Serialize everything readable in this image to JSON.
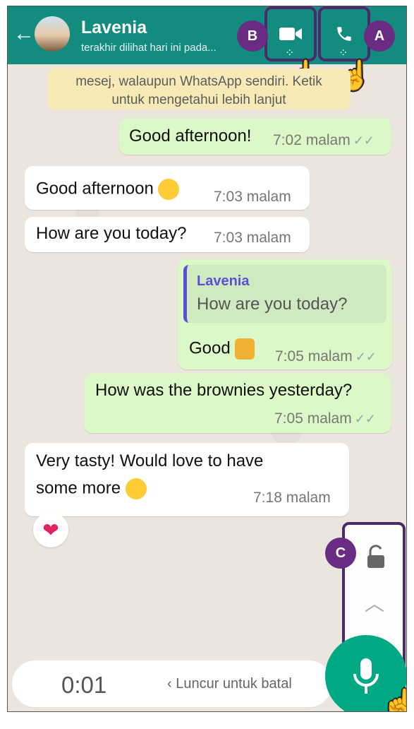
{
  "header": {
    "contact_name": "Lavenia",
    "last_seen": "terakhir dilihat hari ini pada...",
    "accent_color": "#128c7e"
  },
  "callouts": {
    "a": "A",
    "b": "B",
    "c": "C"
  },
  "notice": {
    "line1": "mesej, walaupun WhatsApp sendiri. Ketik",
    "line2": "untuk mengetahui lebih lanjut"
  },
  "messages": [
    {
      "text": "Good afternoon!",
      "time": "7:02 malam"
    },
    {
      "text": "Good afternoon",
      "time": "7:03 malam"
    },
    {
      "text": "How are you today?",
      "time": "7:03 malam"
    },
    {
      "reply_name": "Lavenia",
      "reply_text": "How are you today?",
      "text": "Good",
      "time": "7:05 malam"
    },
    {
      "text": "How was the brownies yesterday?",
      "time": "7:05 malam"
    },
    {
      "text_line1": "Very tasty! Would love to have",
      "text_line2": "some more",
      "time": "7:18 malam"
    }
  ],
  "reaction": "heart",
  "recording": {
    "timer": "0:01",
    "slide_hint": "Luncur untuk batal"
  },
  "icons": [
    "back-arrow-icon",
    "video-call-icon",
    "voice-call-icon",
    "lock-icon",
    "chevron-up-icon",
    "mic-icon",
    "hand-pointer-icon"
  ]
}
